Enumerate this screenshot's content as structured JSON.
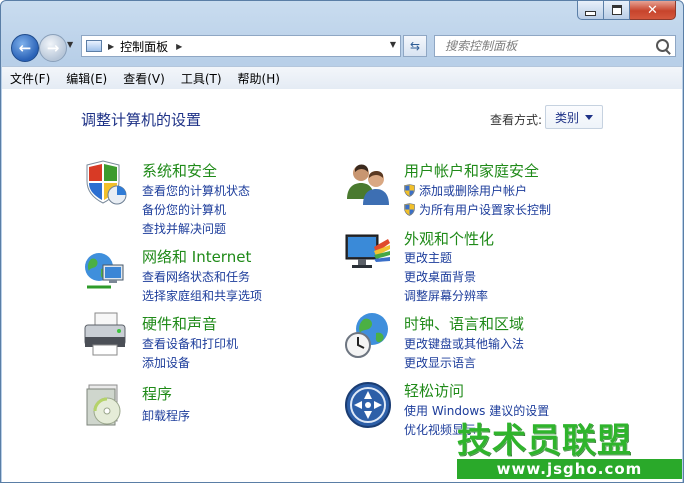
{
  "window": {
    "caption_buttons": [
      "minimize",
      "maximize",
      "close"
    ],
    "close_glyph": "✕"
  },
  "nav": {
    "back_glyph": "←",
    "forward_glyph": "→",
    "address_breadcrumb": "控制面板",
    "search_placeholder": "搜索控制面板"
  },
  "menu": {
    "items": [
      "文件(F)",
      "编辑(E)",
      "查看(V)",
      "工具(T)",
      "帮助(H)"
    ]
  },
  "main": {
    "title": "调整计算机的设置",
    "view_by_label": "查看方式:",
    "view_by_value": "类别"
  },
  "categories": {
    "system": {
      "title": "系统和安全",
      "links": [
        "查看您的计算机状态",
        "备份您的计算机",
        "查找并解决问题"
      ],
      "icon": "shield-computer-icon"
    },
    "network": {
      "title": "网络和 Internet",
      "links": [
        "查看网络状态和任务",
        "选择家庭组和共享选项"
      ],
      "icon": "globe-network-icon"
    },
    "hardware": {
      "title": "硬件和声音",
      "links": [
        "查看设备和打印机",
        "添加设备"
      ],
      "icon": "printer-icon"
    },
    "programs": {
      "title": "程序",
      "links": [
        "卸载程序"
      ],
      "icon": "programs-disc-icon"
    },
    "users": {
      "title": "用户帐户和家庭安全",
      "links": [
        "添加或删除用户帐户",
        "为所有用户设置家长控制"
      ],
      "icon": "users-icon"
    },
    "appearance": {
      "title": "外观和个性化",
      "links": [
        "更改主题",
        "更改桌面背景",
        "调整屏幕分辨率"
      ],
      "icon": "monitor-palette-icon"
    },
    "clock": {
      "title": "时钟、语言和区域",
      "links": [
        "更改键盘或其他输入法",
        "更改显示语言"
      ],
      "icon": "clock-globe-icon"
    },
    "ease": {
      "title": "轻松访问",
      "links": [
        "使用 Windows 建议的设置",
        "优化视频显示"
      ],
      "icon": "ease-of-access-icon"
    }
  },
  "watermark": {
    "text": "技术员联盟",
    "url": "www.jsgho.com"
  }
}
